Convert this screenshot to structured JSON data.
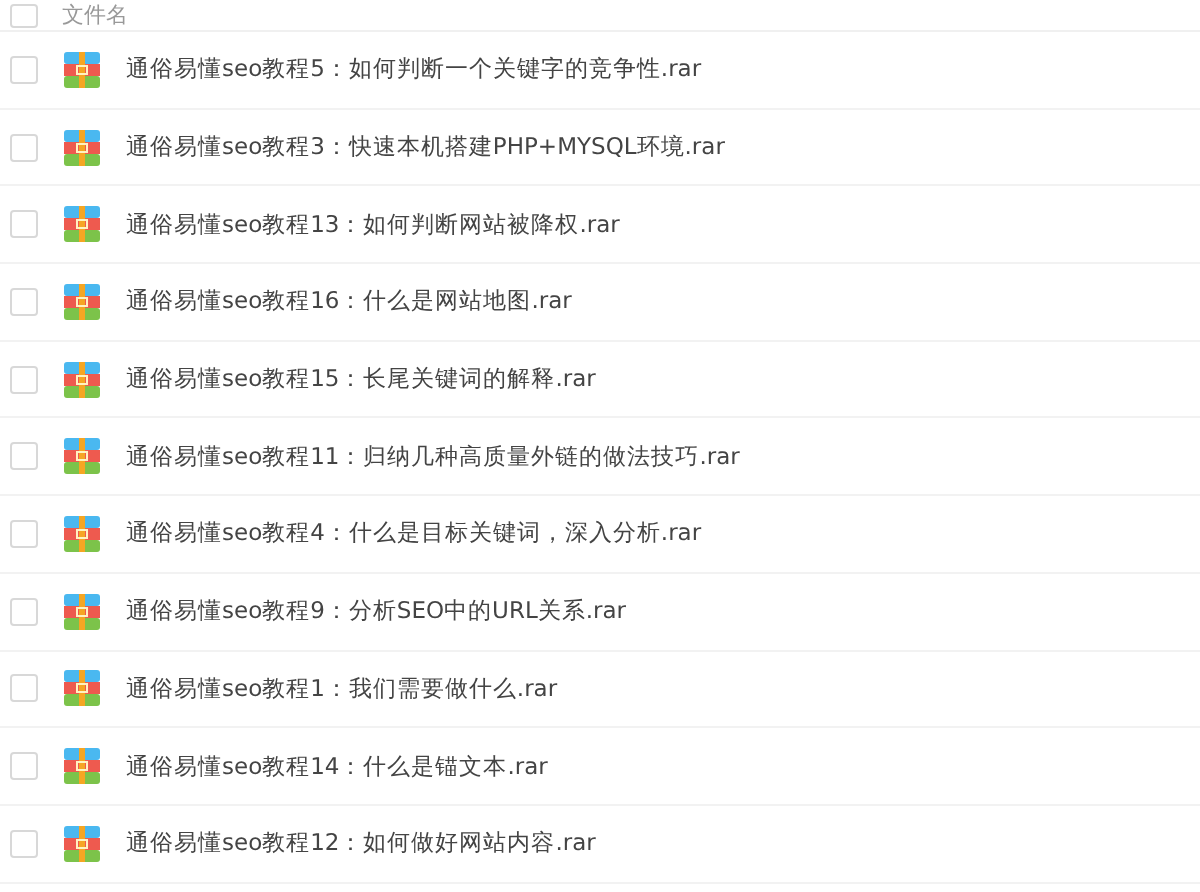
{
  "header": {
    "label": "文件名",
    "checked": false
  },
  "files": [
    {
      "name": "通俗易懂seo教程5：如何判断一个关键字的竞争性.rar",
      "checked": false
    },
    {
      "name": "通俗易懂seo教程3：快速本机搭建PHP+MYSQL环境.rar",
      "checked": false
    },
    {
      "name": "通俗易懂seo教程13：如何判断网站被降权.rar",
      "checked": false
    },
    {
      "name": "通俗易懂seo教程16：什么是网站地图.rar",
      "checked": false
    },
    {
      "name": "通俗易懂seo教程15：长尾关键词的解释.rar",
      "checked": false
    },
    {
      "name": "通俗易懂seo教程11：归纳几种高质量外链的做法技巧.rar",
      "checked": false
    },
    {
      "name": "通俗易懂seo教程4：什么是目标关键词，深入分析.rar",
      "checked": false
    },
    {
      "name": "通俗易懂seo教程9：分析SEO中的URL关系.rar",
      "checked": false
    },
    {
      "name": "通俗易懂seo教程1：我们需要做什么.rar",
      "checked": false
    },
    {
      "name": "通俗易懂seo教程14：什么是锚文本.rar",
      "checked": false
    },
    {
      "name": "通俗易懂seo教程12：如何做好网站内容.rar",
      "checked": false
    }
  ]
}
